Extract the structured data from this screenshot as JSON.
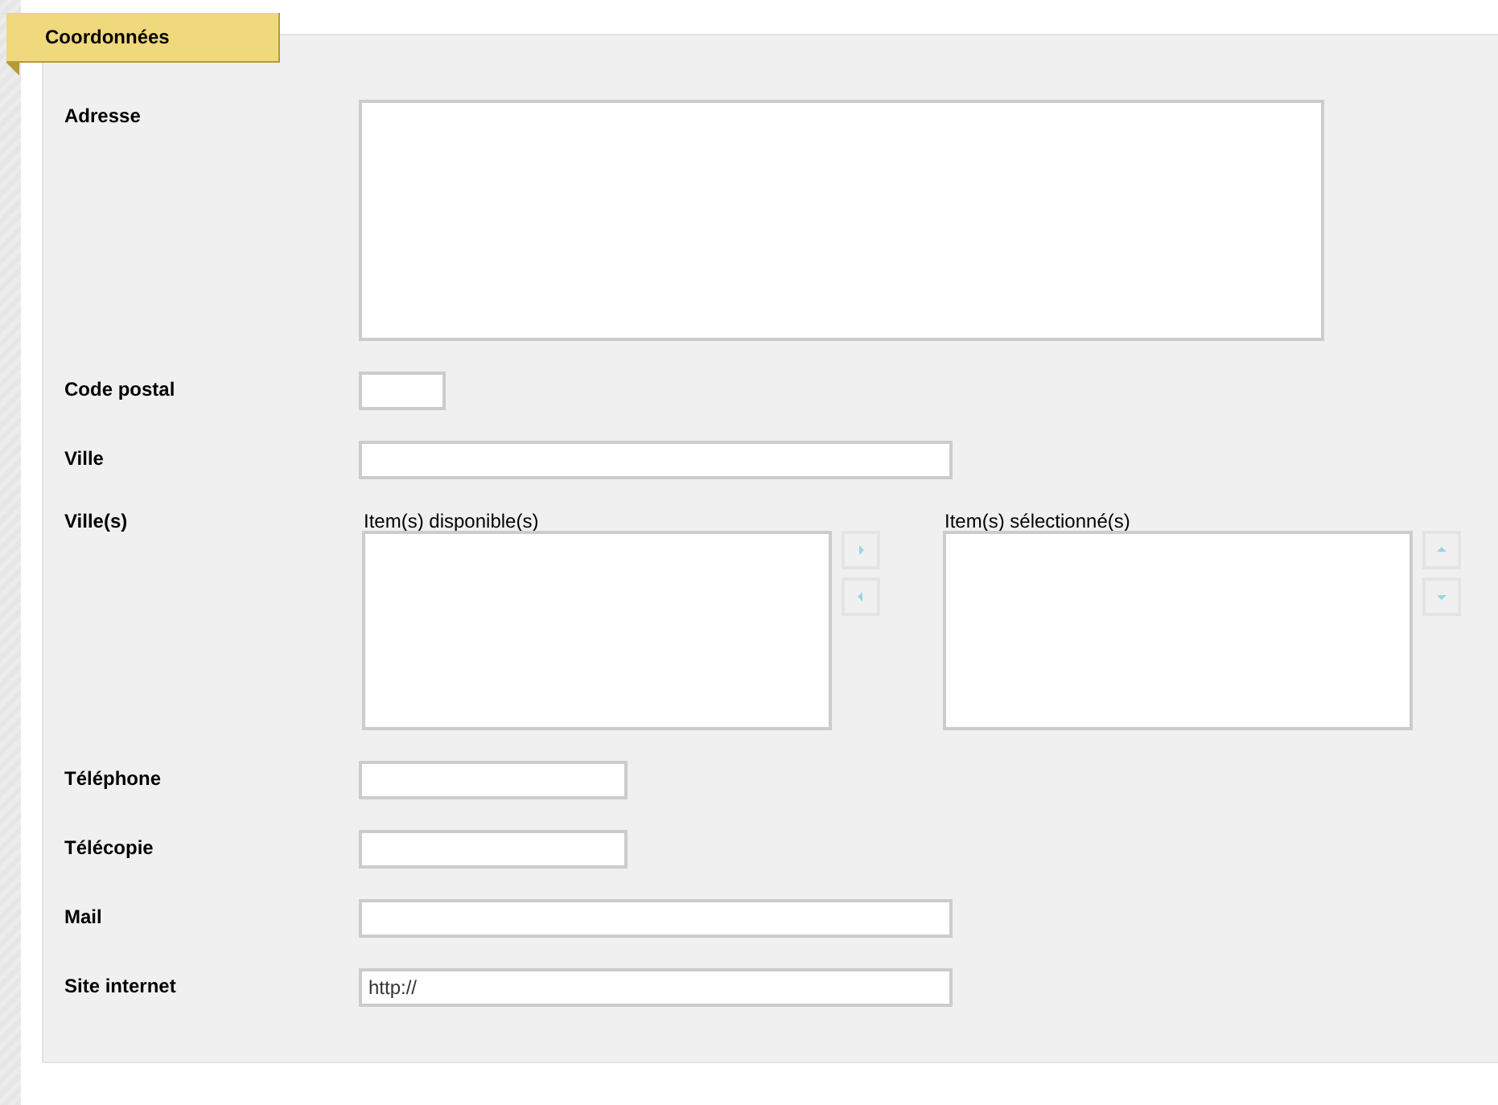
{
  "section": {
    "title": "Coordonnées"
  },
  "fields": [
    {
      "kind": "textarea",
      "label": "Adresse"
    },
    {
      "kind": "short",
      "label": "Code postal"
    },
    {
      "kind": "text",
      "label": "Ville"
    },
    {
      "kind": "duallist",
      "label": "Ville(s)",
      "available_label": "Item(s) disponible(s)",
      "selected_label": "Item(s) sélectionné(s)"
    },
    {
      "kind": "medium",
      "label": "Téléphone"
    },
    {
      "kind": "medium",
      "label": "Télécopie"
    },
    {
      "kind": "text",
      "label": "Mail"
    },
    {
      "kind": "text",
      "label": "Site internet",
      "value": "http://"
    }
  ]
}
